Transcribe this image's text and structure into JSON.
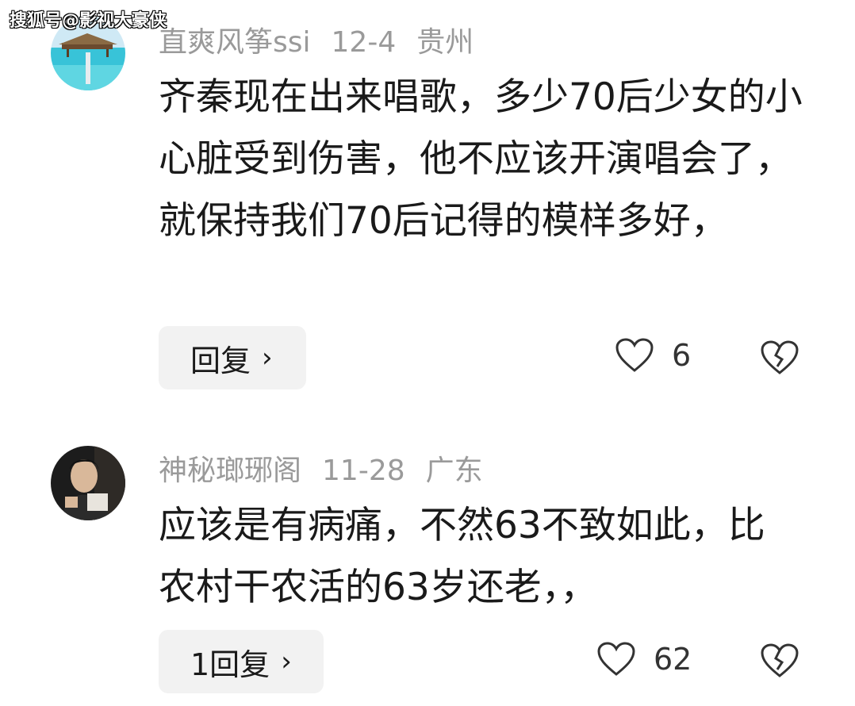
{
  "watermark": "搜狐号@影视大豪侠",
  "comments": [
    {
      "username": "直爽风筝ssi",
      "date": "12-4",
      "location": "贵州",
      "text": "齐秦现在出来唱歌，多少70后少女的小心脏受到伤害，他不应该开演唱会了，就保持我们70后记得的模样多好，",
      "reply_label": "回复",
      "likes": "6",
      "avatar_icon": "beach-bungalow-avatar"
    },
    {
      "username": "神秘瑯琊阁",
      "date": "11-28",
      "location": "广东",
      "text": "应该是有病痛，不然63不致如此，比农村干农活的63岁还老，，",
      "reply_label": "1回复",
      "likes": "62",
      "avatar_icon": "man-portrait-avatar"
    }
  ],
  "icons": {
    "like": "heart-outline-icon",
    "dislike": "broken-heart-icon",
    "chevron": "chevron-right-icon"
  }
}
